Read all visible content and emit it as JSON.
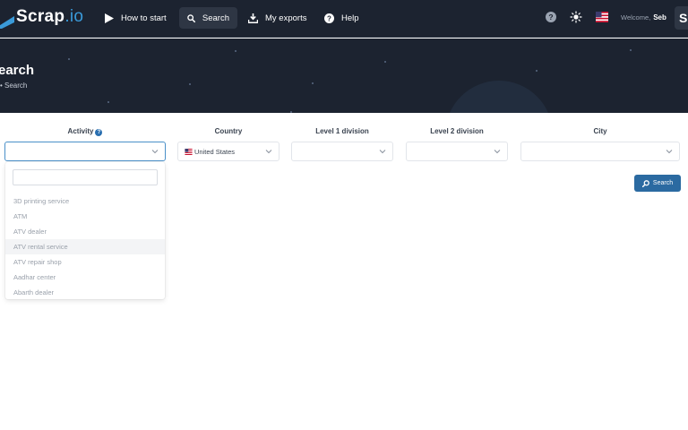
{
  "brand": {
    "name": "Scrap",
    "tld": ".io"
  },
  "nav": {
    "how_to_start": "How to start",
    "search": "Search",
    "my_exports": "My exports",
    "help": "Help"
  },
  "user": {
    "welcome": "Welcome,",
    "name": "Seb",
    "avatar_initial": "S"
  },
  "hero": {
    "title": "earch",
    "breadcrumb": "• Search"
  },
  "filters": {
    "activity": {
      "label": "Activity",
      "help": "?",
      "value": ""
    },
    "country": {
      "label": "Country",
      "value": "United States"
    },
    "level1": {
      "label": "Level 1 division",
      "value": ""
    },
    "level2": {
      "label": "Level 2 division",
      "value": ""
    },
    "city": {
      "label": "City",
      "value": ""
    }
  },
  "search_button": "Search",
  "activity_dropdown": {
    "search_value": "",
    "options": [
      "3D printing service",
      "ATM",
      "ATV dealer",
      "ATV rental service",
      "ATV repair shop",
      "Aadhar center",
      "Abarth dealer"
    ],
    "highlighted": "ATV rental service"
  },
  "colors": {
    "nav_bg": "#1c2330",
    "accent": "#2b6aa1",
    "logo_tld": "#3a9ad9"
  }
}
